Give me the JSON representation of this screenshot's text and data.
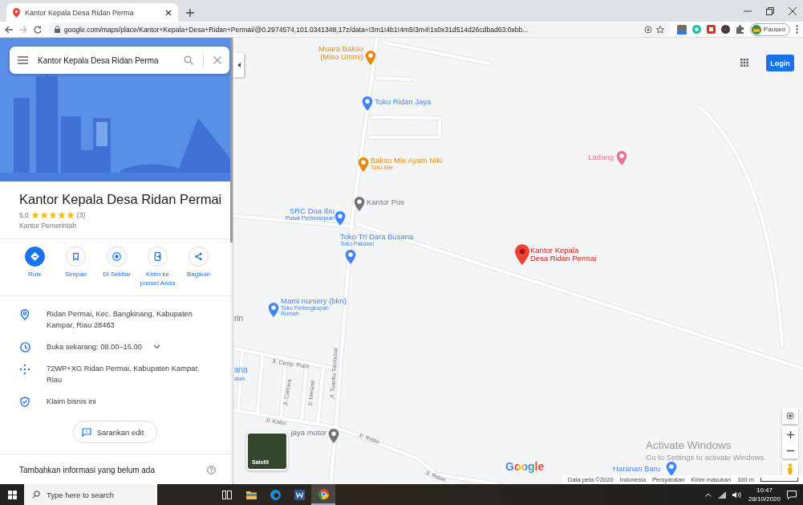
{
  "browser": {
    "tab": {
      "title": "Kantor Kepala Desa Ridan Perma"
    },
    "url": "google.com/maps/place/Kantor+Kepala+Desa+Ridan+Permai/@0.2974574,101.0341348,17z/data=!3m1!4b1!4m5!3m4!1s0x31d514d26cdbad63:0xbb...",
    "profile": {
      "label": "Paused"
    }
  },
  "search": {
    "value": "Kantor Kepala Desa Ridan Perma"
  },
  "place": {
    "name": "Kantor Kepala Desa Ridan Permai",
    "rating": "5,0",
    "stars": 5,
    "reviews": "(3)",
    "category": "Kantor Pemerintah"
  },
  "actions": [
    {
      "kind": "directions",
      "label": "Rute",
      "filled": true
    },
    {
      "kind": "save",
      "label": "Simpan",
      "filled": false
    },
    {
      "kind": "nearby",
      "label": "Di Sekitar",
      "filled": false
    },
    {
      "kind": "send",
      "label": "Kirim ke ponsel Anda",
      "filled": false
    },
    {
      "kind": "share",
      "label": "Bagikan",
      "filled": false
    }
  ],
  "details": [
    {
      "kind": "address",
      "text": "Ridan Permai, Kec. Bangkinang, Kabupaten Kampar, Riau 28463"
    },
    {
      "kind": "hours",
      "text": "Buka sekarang:  08.00–16.00",
      "expanded": false
    },
    {
      "kind": "plus_code",
      "text": "72WP+XG Ridan Permai, Kabupaten Kampar, Riau"
    },
    {
      "kind": "claim",
      "text": "Klaim bisnis ini"
    }
  ],
  "suggest_edit": {
    "label": "Sarankan edit"
  },
  "add_info": {
    "title": "Tambahkan informasi yang belum ada"
  },
  "map": {
    "login": {
      "label": "Login"
    },
    "places": [
      {
        "name": "Muara Bakso\n(Miso Ummi)",
        "color": "#e8890c",
        "selected": false
      },
      {
        "name": "Toko Ridan Jaya",
        "color": "#4285f4",
        "selected": false
      },
      {
        "name": "Bakso Mie Ayam Niki",
        "subtitle": "Toko Mie",
        "color": "#e8890c",
        "selected": false
      },
      {
        "name": "Kantor Pos",
        "color": "#70757a",
        "selected": false
      },
      {
        "name": "SRC Doa Ibu",
        "subtitle": "Pusat Perbelanjaan",
        "color": "#4285f4",
        "selected": false
      },
      {
        "name": "Toko Tri Dara Busana",
        "subtitle": "Toko Pakaian",
        "color": "#4285f4",
        "selected": false
      },
      {
        "name": "Kantor Kepala\nDesa Ridan Permai",
        "color": "#ea4335",
        "selected": true
      },
      {
        "name": "Mami nursery (bkn)",
        "subtitle": "Toko Perlengkapan\nRumah",
        "color": "#4285f4",
        "selected": false
      },
      {
        "name": "Ladang",
        "color": "#e57399",
        "selected": false
      },
      {
        "name": "jaya motor",
        "color": "#70757a",
        "selected": false
      },
      {
        "name": "Haranan Baru",
        "color": "#4285f4",
        "selected": false
      }
    ],
    "edge_labels": [
      "rin",
      "ana",
      "aian"
    ],
    "roads": [
      "Jl. Camp. Putih",
      "Jl. Camara",
      "Jl. Meranti",
      "Jl. Tuanku Tambusai",
      "Jl. Kulim",
      "Jl. Ridan",
      "Jl. Ridan"
    ],
    "layer": {
      "label": "Satelit"
    },
    "logo": "Google",
    "footer": [
      "Data peta ©2020",
      "Indonesia",
      "Persyaratan",
      "Kirim masukan"
    ],
    "scale": "100 m"
  },
  "activation_notice": {
    "title": "Activate Windows",
    "message": "Go to Settings to activate Windows."
  },
  "taskbar": {
    "search_placeholder": "Type here to search",
    "time": "10:47",
    "date": "28/10/2020"
  }
}
